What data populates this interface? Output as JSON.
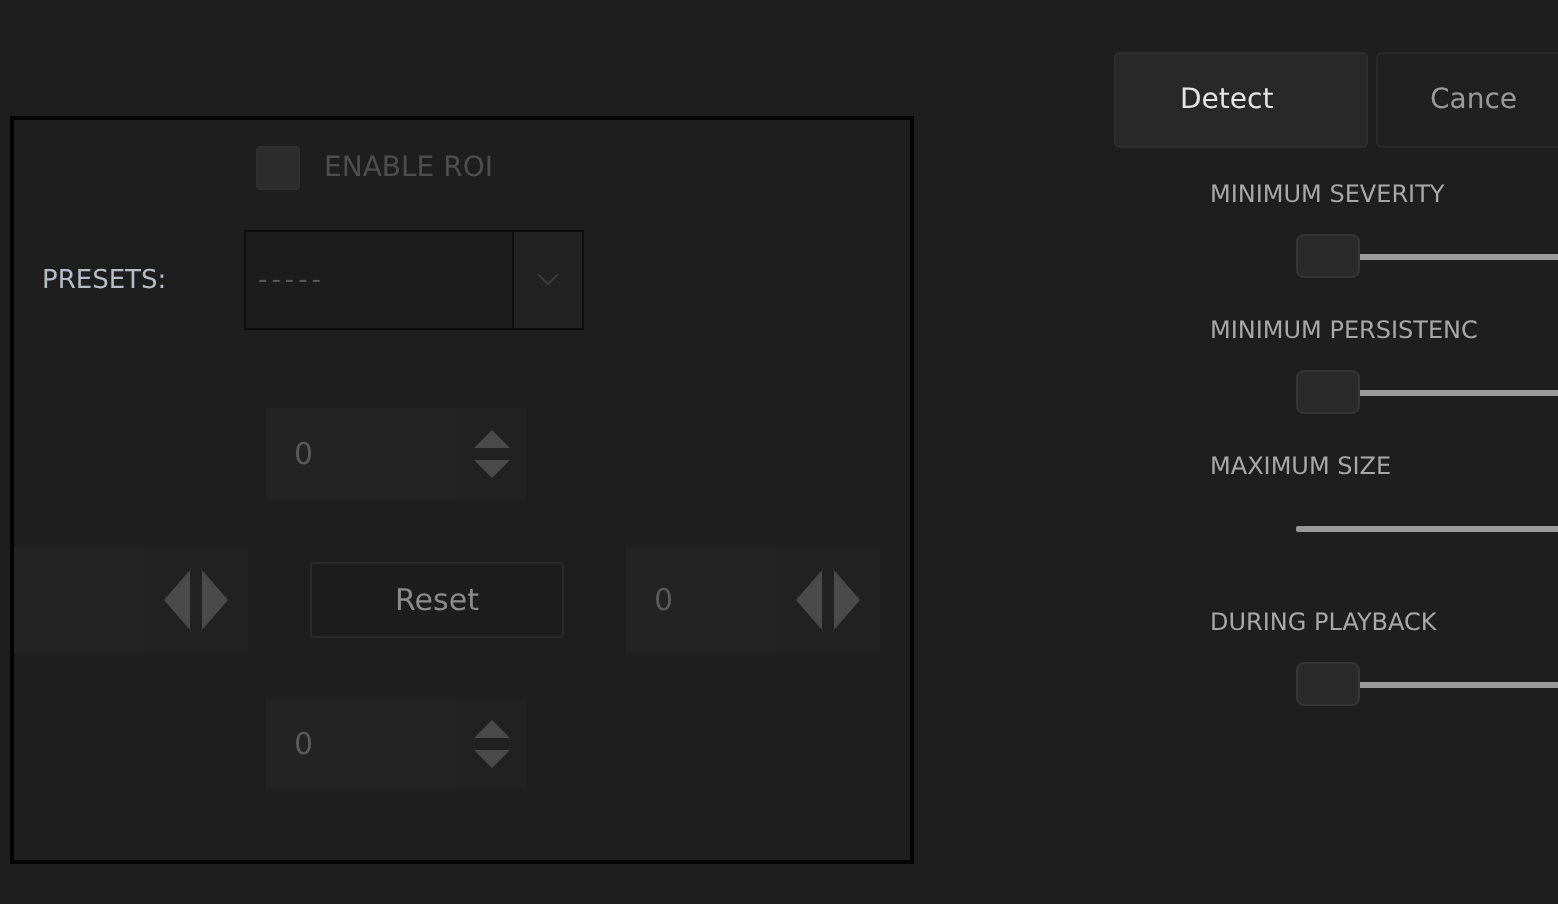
{
  "roi_panel": {
    "enable_roi": {
      "label": "ENABLE ROI",
      "checked": false,
      "disabled": true
    },
    "presets": {
      "label": "PRESETS:",
      "value": "-----"
    },
    "top_offset": {
      "value": "0"
    },
    "reset_button": "Reset",
    "right_offset": {
      "value": "0"
    },
    "bottom_offset": {
      "value": "0"
    }
  },
  "buttons": [
    {
      "label": "Detect",
      "kind": "primary"
    },
    {
      "label": "Cance",
      "kind": "secondary"
    }
  ],
  "sliders": [
    {
      "label": "MINIMUM SEVERITY",
      "level": 0
    },
    {
      "label": "MINIMUM PERSISTENC",
      "level": 0
    },
    {
      "label": "MAXIMUM SIZE"
    },
    {
      "label": "DURING PLAYBACK",
      "level": 0
    }
  ]
}
